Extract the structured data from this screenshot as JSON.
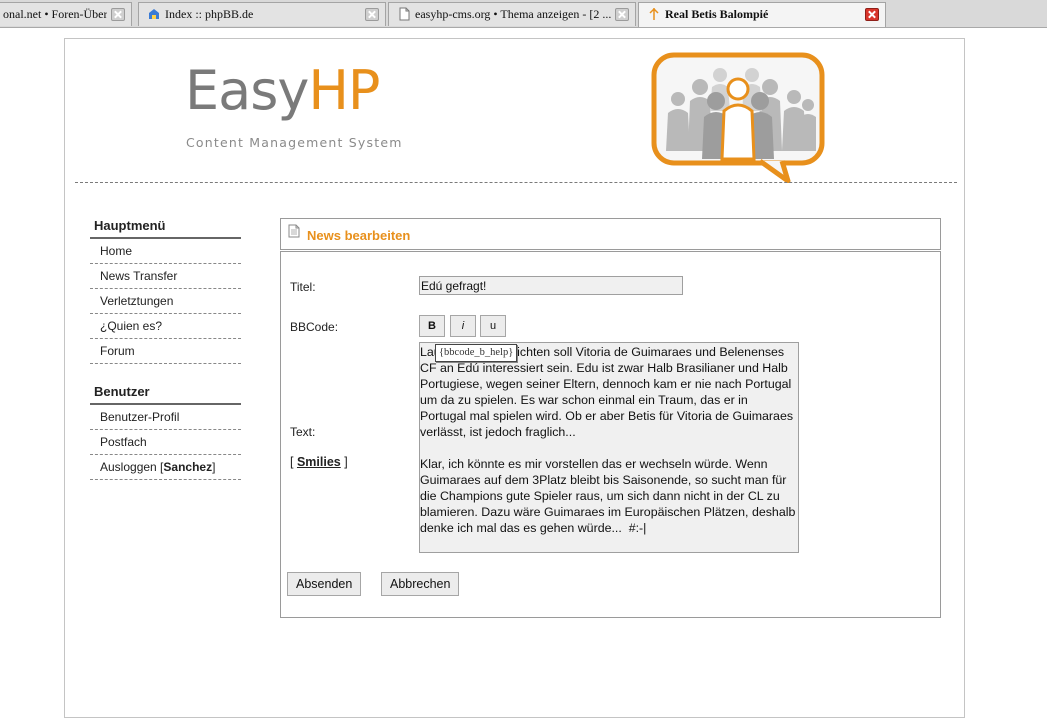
{
  "browser": {
    "tabs": [
      {
        "title": "onal.net • Foren-Über...",
        "icon": "none",
        "active": false
      },
      {
        "title": "Index :: phpBB.de",
        "icon": "phpbb-favicon",
        "active": false
      },
      {
        "title": "easyhp-cms.org • Thema anzeigen - [2 ...",
        "icon": "document-icon",
        "active": false
      },
      {
        "title": "Real Betis Balompié",
        "icon": "loading-favicon",
        "active": true
      }
    ]
  },
  "header": {
    "logo_easy": "Easy",
    "logo_hp": "HP",
    "logo_tagline": "Content Management System"
  },
  "sidebar": {
    "main_title": "Hauptmenü",
    "main_items": [
      {
        "label": "Home"
      },
      {
        "label": "News Transfer"
      },
      {
        "label": "Verletztungen"
      },
      {
        "label": "¿Quien es?"
      },
      {
        "label": "Forum"
      }
    ],
    "user_title": "Benutzer",
    "user_items": [
      {
        "label": "Benutzer-Profil"
      },
      {
        "label": "Postfach"
      }
    ],
    "logout_label": "Ausloggen [",
    "logout_user": "Sanchez",
    "logout_suffix": "]"
  },
  "content": {
    "panel_title": "News bearbeiten",
    "title_label": "Titel:",
    "title_value": "Edú gefragt!",
    "bbcode_label": "BBCode:",
    "bbcode_buttons": {
      "bold": "B",
      "italic": "i",
      "underline": "u"
    },
    "tooltip": "{bbcode_b_help}",
    "text_label": "Text:",
    "text_value": "Laut diversen Berichten soll Vitoria de Guimaraes und Belenenses CF an Edú interessiert sein. Edu ist zwar Halb Brasilianer und Halb Portugiese, wegen seiner Eltern, dennoch kam er nie nach Portugal um da zu spielen. Es war schon einmal ein Traum, das er in Portugal mal spielen wird. Ob er aber Betis für Vitoria de Guimaraes verlässt, ist jedoch fraglich...\n\nKlar, ich könnte es mir vorstellen das er wechseln würde. Wenn Guimaraes auf dem 3Platz bleibt bis Saisonende, so sucht man für die Champions gute Spieler raus, um sich dann nicht in der CL zu blamieren. Dazu wäre Guimaraes im Europäischen Plätzen, deshalb denke ich mal das es gehen würde...  #:-|",
    "smilies_open": "[",
    "smilies_link": "Smilies",
    "smilies_close": "]",
    "submit_label": "Absenden",
    "cancel_label": "Abbrechen"
  },
  "colors": {
    "accent": "#e8901c",
    "logo_gray": "#7a7a7a"
  }
}
